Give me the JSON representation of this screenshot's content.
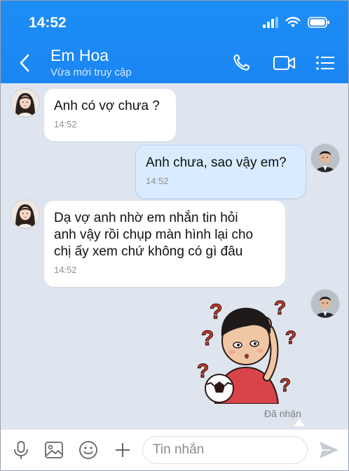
{
  "status_bar": {
    "time": "14:52"
  },
  "header": {
    "contact_name": "Em Hoa",
    "presence": "Vừa mới truy cập"
  },
  "messages": [
    {
      "text": "Anh có vợ chưa ?",
      "time": "14:52"
    },
    {
      "text": "Anh chưa, sao vậy em?",
      "time": "14:52"
    },
    {
      "lines": [
        "Dạ vợ anh nhờ em nhắn tin hỏi",
        "anh vậy rồi chụp màn hình lại cho",
        "chị ấy xem chứ không có gì đâu"
      ],
      "time": "14:52"
    }
  ],
  "delivery_status": "Đã nhận",
  "composer": {
    "placeholder": "Tin nhắn"
  },
  "colors": {
    "header": "#1b86f3",
    "background": "#dfe5ee",
    "outgoing_bubble": "#d9ecff",
    "incoming_bubble": "#ffffff"
  },
  "icons": {
    "header": [
      "back-chevron-icon",
      "phone-icon",
      "video-camera-icon",
      "menu-list-icon"
    ],
    "composer": [
      "microphone-icon",
      "image-icon",
      "emoji-icon",
      "plus-icon",
      "send-icon"
    ]
  }
}
